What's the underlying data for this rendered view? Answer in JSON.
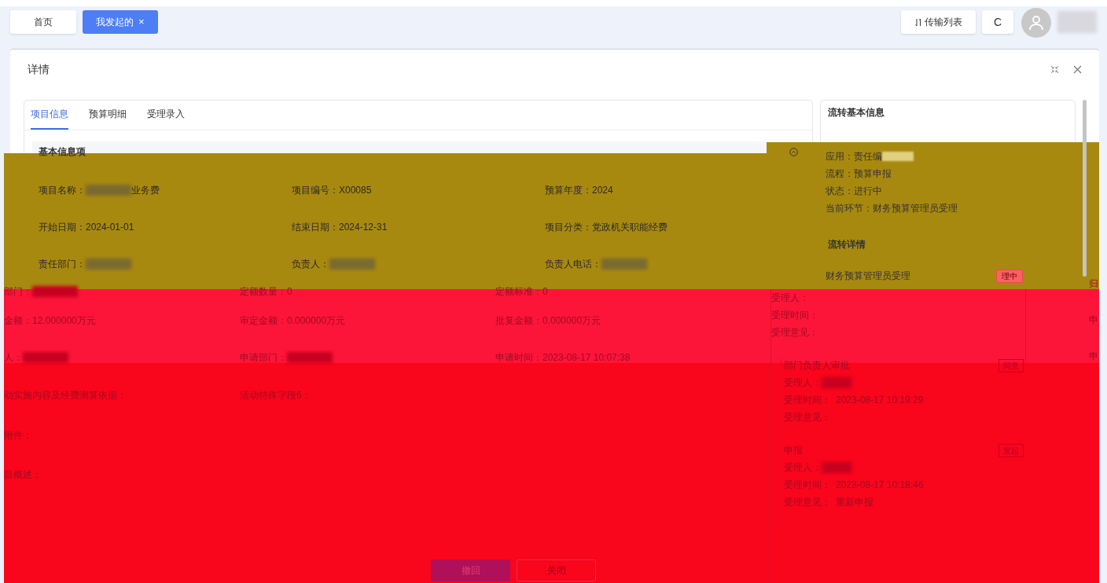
{
  "top_tabs": [
    {
      "label": "首页",
      "selected": false
    },
    {
      "label": "我发起的",
      "selected": true,
      "close_icon": "×"
    }
  ],
  "toolbar": {
    "transfer_label": "传输列表",
    "refresh_label": "C"
  },
  "dialog": {
    "title": "详情",
    "tabs": [
      {
        "label": "项目信息",
        "selected": true
      },
      {
        "label": "预算明细",
        "selected": false
      },
      {
        "label": "受理录入",
        "selected": false
      }
    ],
    "section_title": "基本信息项",
    "fields": [
      [
        {
          "label": "项目名称：",
          "redacted": true,
          "value": "业务费"
        },
        {
          "label": "项目编号：",
          "value": "X00085"
        },
        {
          "label": "预算年度：",
          "value": "2024"
        }
      ],
      [
        {
          "label": "开始日期：",
          "value": "2024-01-01"
        },
        {
          "label": "结束日期：",
          "value": "2024-12-31"
        },
        {
          "label": "项目分类：",
          "value": "党政机关职能经费"
        }
      ],
      [
        {
          "label": "责任部门：",
          "redacted": true
        },
        {
          "label": "负责人：",
          "redacted": true
        },
        {
          "label": "负责人电话：",
          "redacted": true
        }
      ]
    ],
    "lower_fields": [
      [
        {
          "label": "部门：",
          "redacted": true
        },
        {
          "label": "定额数量：",
          "value": "0"
        },
        {
          "label": "定额标准：",
          "value": "0"
        }
      ],
      [
        {
          "label": "金额：",
          "value": "12.000000万元"
        },
        {
          "label": "审定金额：",
          "value": "0.000000万元"
        },
        {
          "label": "批复金额：",
          "value": "0.000000万元"
        }
      ],
      [
        {
          "label": "人：",
          "redacted": true
        },
        {
          "label": "申请部门：",
          "redacted": true
        },
        {
          "label": "申请时间：",
          "value": "2023-08-17 10:07:38"
        }
      ],
      [
        {
          "label": "动实施内容及经费测算依据："
        },
        {
          "label": "活动特殊字段6："
        }
      ],
      [
        {
          "label": "附件："
        }
      ],
      [
        {
          "label": "目概述："
        }
      ]
    ],
    "flow_basic": {
      "title": "流转基本信息",
      "lines": [
        {
          "label": "应用：",
          "value": "责任编",
          "redacted": true
        },
        {
          "label": "流程：",
          "value": "预算申报"
        },
        {
          "label": "状态：",
          "value": "进行中"
        },
        {
          "label": "当前环节：",
          "value": "财务预算管理员受理"
        }
      ]
    },
    "flow_detail": {
      "title": "流转详情",
      "current": {
        "name": "财务预算管理员受理",
        "tag": "理中",
        "lines": [
          {
            "label": "受理人："
          },
          {
            "label": "受理时间："
          },
          {
            "label": "受理意见："
          }
        ]
      },
      "steps": [
        {
          "name": "部门负责人审批",
          "tag": "同意",
          "lines": [
            {
              "label": "受理人：",
              "redacted": true
            },
            {
              "label": "受理时间：",
              "value": "2023-08-17 10:19:29"
            },
            {
              "label": "受理意见："
            }
          ]
        },
        {
          "name": "申报",
          "tag": "发起",
          "lines": [
            {
              "label": "受理人：",
              "redacted": true
            },
            {
              "label": "受理时间：",
              "value": "2023-08-17 10:18:46"
            },
            {
              "label": "受理意见：",
              "value": "重新申报"
            }
          ]
        }
      ]
    },
    "edge_fragments": [
      "归",
      "申",
      "申"
    ],
    "buttons": [
      {
        "label": "撤回",
        "kind": "primary"
      },
      {
        "label": "关闭",
        "kind": "plain"
      }
    ]
  }
}
